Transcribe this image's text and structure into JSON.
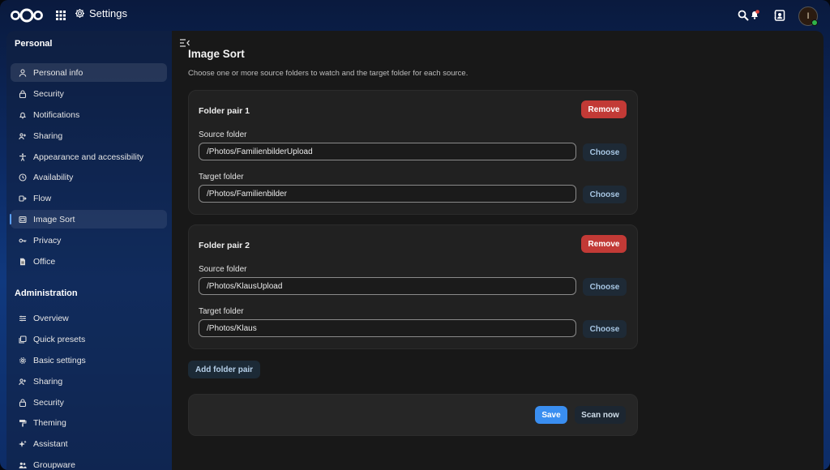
{
  "header": {
    "app_title": "Settings",
    "avatar_initial": "I"
  },
  "sidebar": {
    "personal_caption": "Personal",
    "personal_items": [
      {
        "label": "Personal info",
        "icon": "user-icon"
      },
      {
        "label": "Security",
        "icon": "lock-icon"
      },
      {
        "label": "Notifications",
        "icon": "bell-icon"
      },
      {
        "label": "Sharing",
        "icon": "share-icon"
      },
      {
        "label": "Appearance and accessibility",
        "icon": "accessibility-icon"
      },
      {
        "label": "Availability",
        "icon": "clock-icon"
      },
      {
        "label": "Flow",
        "icon": "flow-icon"
      },
      {
        "label": "Image Sort",
        "icon": "image-sort-icon"
      },
      {
        "label": "Privacy",
        "icon": "key-icon"
      },
      {
        "label": "Office",
        "icon": "document-icon"
      }
    ],
    "admin_caption": "Administration",
    "admin_items": [
      {
        "label": "Overview",
        "icon": "overview-icon"
      },
      {
        "label": "Quick presets",
        "icon": "presets-icon"
      },
      {
        "label": "Basic settings",
        "icon": "gear-icon"
      },
      {
        "label": "Sharing",
        "icon": "share-icon"
      },
      {
        "label": "Security",
        "icon": "lock-icon"
      },
      {
        "label": "Theming",
        "icon": "paint-roller-icon"
      },
      {
        "label": "Assistant",
        "icon": "sparkle-icon"
      },
      {
        "label": "Groupware",
        "icon": "group-icon"
      }
    ]
  },
  "main": {
    "title": "Image Sort",
    "description": "Choose one or more source folders to watch and the target folder for each source.",
    "pairs": [
      {
        "title": "Folder pair 1",
        "remove_label": "Remove",
        "source_label": "Source folder",
        "source_value": "/Photos/FamilienbilderUpload",
        "target_label": "Target folder",
        "target_value": "/Photos/Familienbilder",
        "choose_label": "Choose"
      },
      {
        "title": "Folder pair 2",
        "remove_label": "Remove",
        "source_label": "Source folder",
        "source_value": "/Photos/KlausUpload",
        "target_label": "Target folder",
        "target_value": "/Photos/Klaus",
        "choose_label": "Choose"
      }
    ],
    "add_pair_label": "Add folder pair",
    "save_label": "Save",
    "scan_label": "Scan now"
  },
  "colors": {
    "accent": "#3a8ef0",
    "danger": "#c23a36",
    "online": "#2fb34a"
  }
}
